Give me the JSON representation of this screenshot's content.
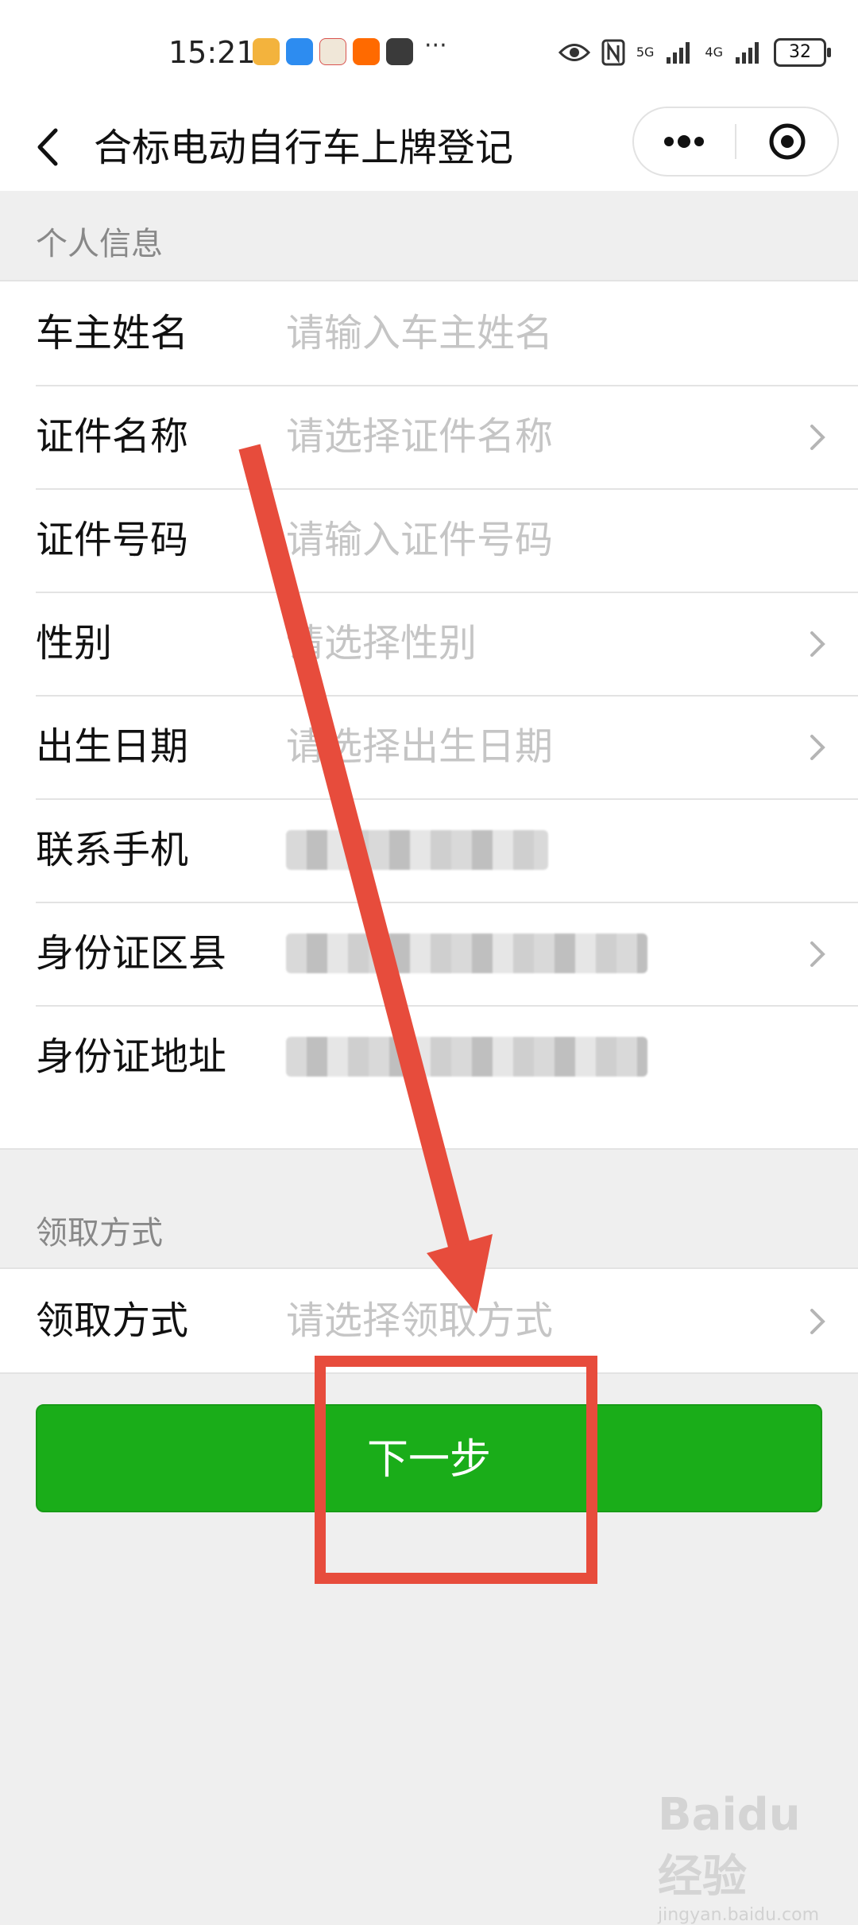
{
  "status_bar": {
    "time": "15:21",
    "more_indicator": "···",
    "network_5g": "5G",
    "network_4g": "4G",
    "battery": "32",
    "icons": [
      "weibo-icon",
      "weather-icon",
      "app-icon",
      "taobao-icon",
      "huawei-icon",
      "eye-icon",
      "nfc-icon",
      "signal-icon",
      "signal-icon",
      "battery-icon"
    ]
  },
  "nav": {
    "title": "合标电动自行车上牌登记"
  },
  "section_personal": {
    "title": "个人信息",
    "rows": [
      {
        "label": "车主姓名",
        "placeholder": "请输入车主姓名"
      },
      {
        "label": "证件名称",
        "placeholder": "请选择证件名称"
      },
      {
        "label": "证件号码",
        "placeholder": "请输入证件号码"
      },
      {
        "label": "性别",
        "placeholder": "请选择性别"
      },
      {
        "label": "出生日期",
        "placeholder": "请选择出生日期"
      },
      {
        "label": "联系手机"
      },
      {
        "label": "身份证区县"
      },
      {
        "label": "身份证地址"
      }
    ]
  },
  "section_pickup": {
    "title": "领取方式",
    "rows": [
      {
        "label": "领取方式",
        "placeholder": "请选择领取方式"
      }
    ]
  },
  "next_button": {
    "label": "下一步"
  },
  "watermark": {
    "brand": "Baidu经验",
    "sub": "jingyan.baidu.com"
  },
  "colors": {
    "primary_green": "#1aad19",
    "annotation_red": "#e74c3c",
    "placeholder_gray": "#c5c5c5",
    "page_bg": "#efefef"
  }
}
